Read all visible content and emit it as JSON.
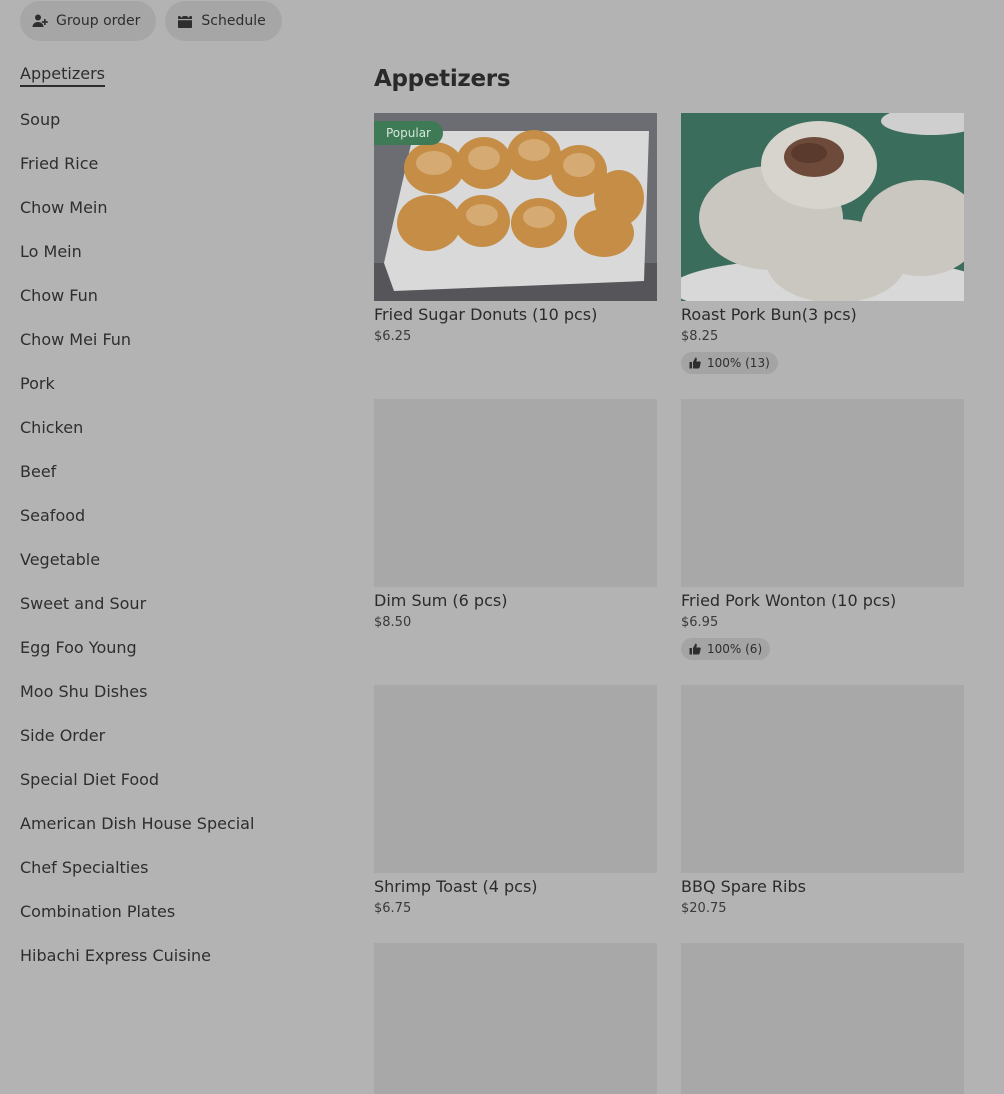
{
  "top_actions": {
    "group_order_label": "Group order",
    "schedule_label": "Schedule"
  },
  "sidebar": {
    "items": [
      {
        "label": "Appetizers",
        "active": true
      },
      {
        "label": "Soup"
      },
      {
        "label": "Fried Rice"
      },
      {
        "label": "Chow Mein"
      },
      {
        "label": "Lo Mein"
      },
      {
        "label": "Chow Fun"
      },
      {
        "label": "Chow Mei Fun"
      },
      {
        "label": "Pork"
      },
      {
        "label": "Chicken"
      },
      {
        "label": "Beef"
      },
      {
        "label": "Seafood"
      },
      {
        "label": "Vegetable"
      },
      {
        "label": "Sweet and Sour"
      },
      {
        "label": "Egg Foo Young"
      },
      {
        "label": "Moo Shu Dishes"
      },
      {
        "label": "Side Order"
      },
      {
        "label": "Special Diet Food"
      },
      {
        "label": "American Dish House Special"
      },
      {
        "label": "Chef Specialties"
      },
      {
        "label": "Combination Plates"
      },
      {
        "label": "Hibachi Express Cuisine"
      }
    ]
  },
  "section": {
    "title": "Appetizers"
  },
  "items": [
    {
      "name": "Fried Sugar Donuts (10 pcs)",
      "price": "$6.25",
      "badge": "Popular",
      "image": "fried-sugar-donuts-photo"
    },
    {
      "name": "Roast Pork Bun(3 pcs)",
      "price": "$8.25",
      "rating": "100% (13)",
      "image": "roast-pork-bun-photo"
    },
    {
      "name": "Dim Sum (6 pcs)",
      "price": "$8.50"
    },
    {
      "name": "Fried Pork Wonton (10 pcs)",
      "price": "$6.95",
      "rating": "100% (6)"
    },
    {
      "name": "Shrimp Toast (4 pcs)",
      "price": "$6.75"
    },
    {
      "name": "BBQ Spare Ribs",
      "price": "$20.75"
    },
    {
      "name": "",
      "price": ""
    },
    {
      "name": "",
      "price": ""
    }
  ],
  "colors": {
    "overlay_bg": "#b3b3b3",
    "badge_green": "#3d7a55"
  }
}
